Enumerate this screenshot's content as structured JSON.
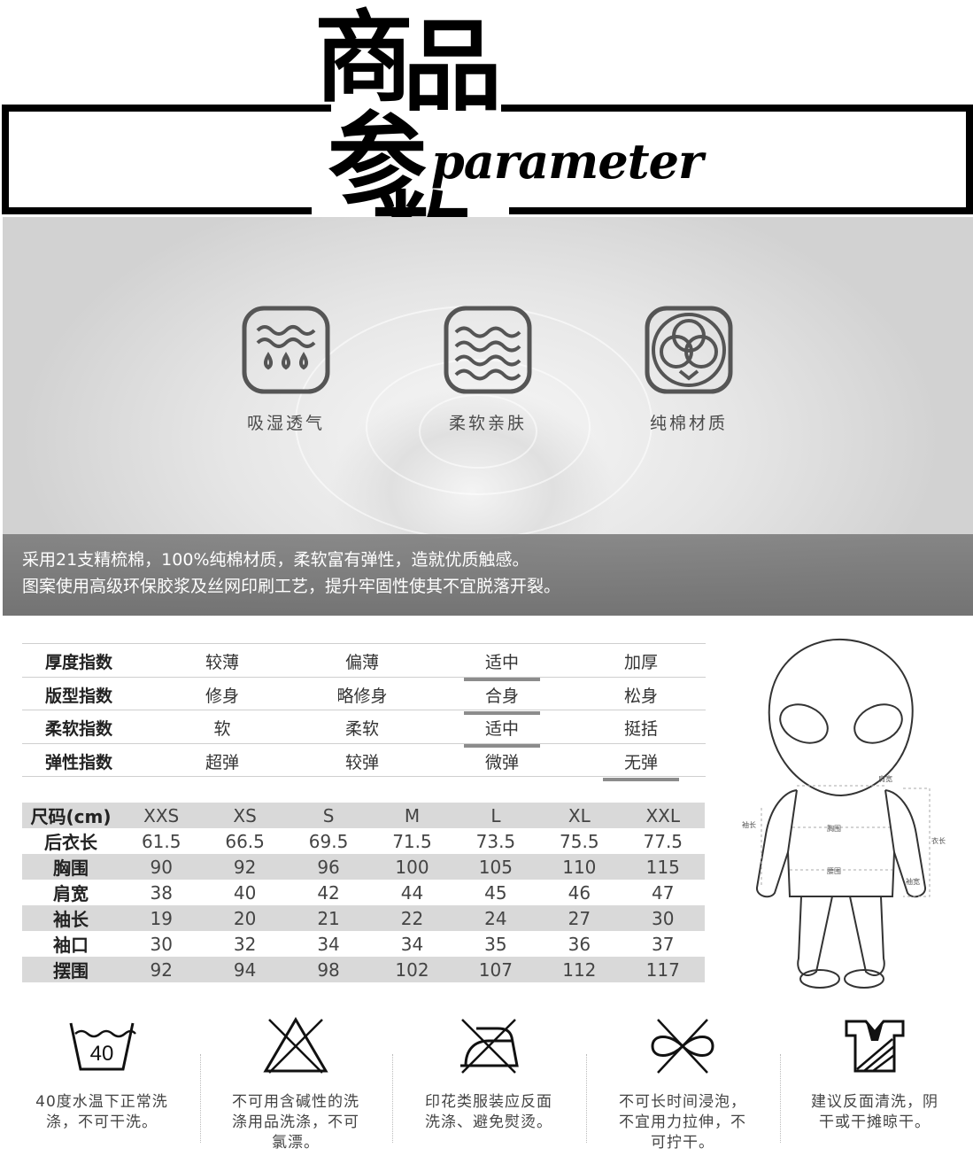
{
  "header": {
    "title_chars": [
      "商",
      "品",
      "参",
      "数"
    ],
    "title_en": "parameter"
  },
  "features": [
    {
      "label": "吸湿透气",
      "icon": "water-drops-icon"
    },
    {
      "label": "柔软亲肤",
      "icon": "waves-icon"
    },
    {
      "label": "纯棉材质",
      "icon": "cotton-icon"
    }
  ],
  "fabric_description": [
    "采用21支精梳棉，100%纯棉材质，柔软富有弹性，造就优质触感。",
    "图案使用高级环保胶浆及丝网印刷工艺，提升牢固性使其不宜脱落开裂。"
  ],
  "index_table": [
    {
      "title": "厚度指数",
      "options": [
        "较薄",
        "偏薄",
        "适中",
        "加厚"
      ],
      "selected": 2
    },
    {
      "title": "版型指数",
      "options": [
        "修身",
        "略修身",
        "合身",
        "松身"
      ],
      "selected": 2
    },
    {
      "title": "柔软指数",
      "options": [
        "软",
        "柔软",
        "适中",
        "挺括"
      ],
      "selected": 2
    },
    {
      "title": "弹性指数",
      "options": [
        "超弹",
        "较弹",
        "微弹",
        "无弹"
      ],
      "selected": 3
    }
  ],
  "size_table": {
    "header": "尺码(cm)",
    "sizes": [
      "XXS",
      "XS",
      "S",
      "M",
      "L",
      "XL",
      "XXL"
    ],
    "rows": [
      {
        "label": "后衣长",
        "values": [
          "61.5",
          "66.5",
          "69.5",
          "71.5",
          "73.5",
          "75.5",
          "77.5"
        ]
      },
      {
        "label": "胸围",
        "values": [
          "90",
          "92",
          "96",
          "100",
          "105",
          "110",
          "115"
        ]
      },
      {
        "label": "肩宽",
        "values": [
          "38",
          "40",
          "42",
          "44",
          "45",
          "46",
          "47"
        ]
      },
      {
        "label": "袖长",
        "values": [
          "19",
          "20",
          "21",
          "22",
          "24",
          "27",
          "30"
        ]
      },
      {
        "label": "袖口",
        "values": [
          "30",
          "32",
          "34",
          "34",
          "35",
          "36",
          "37"
        ]
      },
      {
        "label": "摆围",
        "values": [
          "92",
          "94",
          "98",
          "102",
          "107",
          "112",
          "117"
        ]
      }
    ]
  },
  "figure_labels": {
    "shoulder": "肩宽",
    "sleeve": "袖长",
    "chest": "胸围",
    "length": "衣长",
    "hem": "腰围",
    "cuff": "袖宽"
  },
  "care": [
    {
      "icon": "wash-40-icon",
      "symbol_text": "40",
      "lines": [
        "40度水温下正常洗",
        "涤，不可干洗。"
      ]
    },
    {
      "icon": "no-bleach-icon",
      "lines": [
        "不可用含碱性的洗",
        "涤用品洗涤，不可",
        "氯漂。"
      ]
    },
    {
      "icon": "no-iron-icon",
      "lines": [
        "印花类服装应反面",
        "洗涤、避免熨烫。"
      ]
    },
    {
      "icon": "no-wring-icon",
      "lines": [
        "不可长时间浸泡，",
        "不宜用力拉伸，不",
        "可拧干。"
      ]
    },
    {
      "icon": "flat-dry-icon",
      "lines": [
        "建议反面清洗，阴",
        "干或干摊晾干。"
      ]
    }
  ]
}
